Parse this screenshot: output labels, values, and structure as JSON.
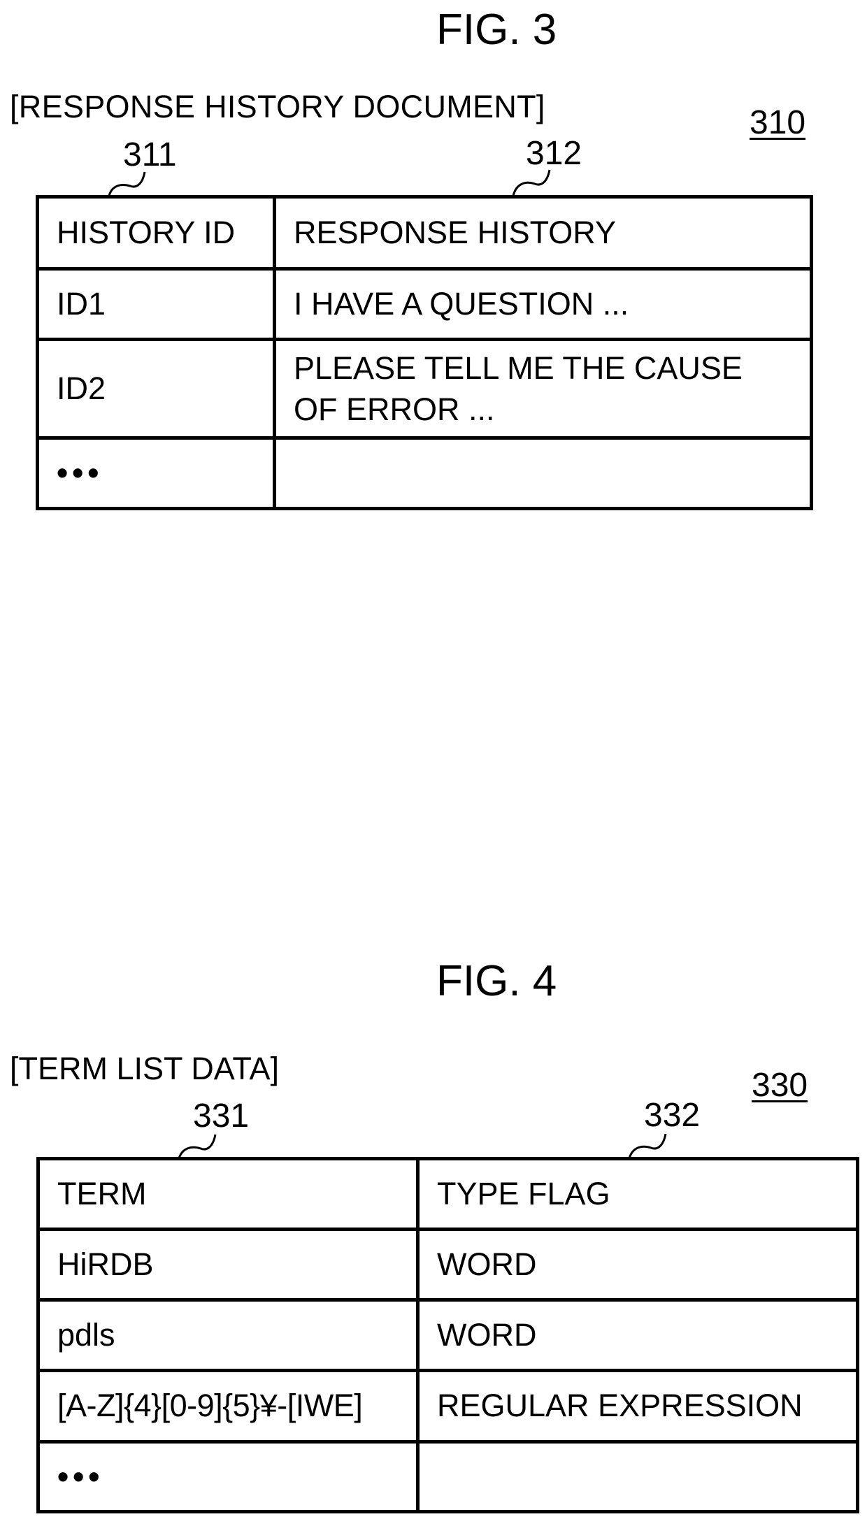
{
  "fig3": {
    "title": "FIG. 3",
    "label": "[RESPONSE HISTORY DOCUMENT]",
    "ref_table": "310",
    "ref_col1": "311",
    "ref_col2": "312",
    "columns": [
      "HISTORY ID",
      "RESPONSE HISTORY"
    ],
    "rows": [
      [
        "ID1",
        "I HAVE A QUESTION ..."
      ],
      [
        "ID2",
        "PLEASE TELL ME THE CAUSE OF ERROR ..."
      ],
      [
        "•••",
        ""
      ]
    ]
  },
  "fig4": {
    "title": "FIG. 4",
    "label": "[TERM LIST DATA]",
    "ref_table": "330",
    "ref_col1": "331",
    "ref_col2": "332",
    "columns": [
      "TERM",
      "TYPE FLAG"
    ],
    "rows": [
      [
        "HiRDB",
        "WORD"
      ],
      [
        "pdls",
        "WORD"
      ],
      [
        "[A-Z]{4}[0-9]{5}¥-[IWE]",
        "REGULAR EXPRESSION"
      ],
      [
        "•••",
        ""
      ]
    ]
  }
}
